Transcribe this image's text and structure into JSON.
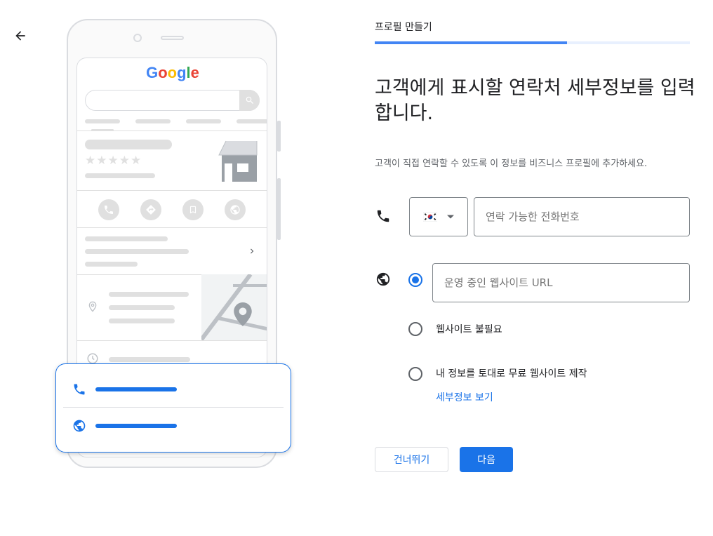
{
  "header": {
    "back_icon": "arrow-back-icon",
    "step_label": "프로필 만들기",
    "progress": 0.61
  },
  "illustration": {
    "logo_text": "Google",
    "rating_stars": "★★★★★",
    "icons": [
      "search-icon",
      "phone-icon",
      "directions-icon",
      "bookmark-icon",
      "globe-icon",
      "chevron-right-icon",
      "location-pin-icon",
      "clock-icon",
      "storefront-icon",
      "map-pin-icon"
    ]
  },
  "form": {
    "heading": "고객에게 표시할 연락처 세부정보를 입력합니다.",
    "subtext": "고객이 직접 연락할 수 있도록 이 정보를 비즈니스 프로필에 추가하세요.",
    "country_flag": "🇰🇷",
    "phone_placeholder": "연락 가능한 전화번호",
    "website_placeholder": "운영 중인 웹사이트 URL",
    "options": [
      {
        "label": "웹사이트 불필요",
        "checked": false
      },
      {
        "label": "내 정보를 토대로 무료 웹사이트 제작",
        "checked": false
      }
    ],
    "details_link": "세부정보 보기"
  },
  "actions": {
    "skip_label": "건너뛰기",
    "next_label": "다음"
  },
  "colors": {
    "accent": "#1a73e8",
    "progress": "#4285f4",
    "progress_track": "#e8f0fe",
    "placeholder_gray": "#e0e0e0"
  }
}
